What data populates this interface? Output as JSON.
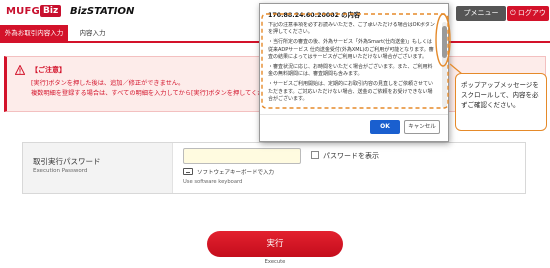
{
  "header": {
    "logo_mufg": "MUFG",
    "logo_biz": "Biz",
    "logo_bizstation": "BizSTATION",
    "menu_label": "プメニュー",
    "logout_label": "ログアウト"
  },
  "tabs": [
    {
      "label": "外為お取引内容入力",
      "active": true
    },
    {
      "label": "内容入力",
      "active": false
    }
  ],
  "warning": {
    "title": "【ご注意】",
    "line1": "[実行]ボタンを押した後は、追加／修正ができません。",
    "line2": "複数明細を登録する場合は、すべての明細を入力してから[実行]ボタンを押してください。"
  },
  "form": {
    "label": "取引実行パスワード",
    "sublabel": "Execution Password",
    "show_password": "パスワードを表示",
    "software_keyboard": "ソフトウェアキーボードで入力",
    "software_keyboard_en": "Use software keyboard"
  },
  "execute": {
    "label": "実行",
    "sublabel": "Execute"
  },
  "popup": {
    "title": "170.88.24.60:20002 の内容",
    "paragraphs": [
      "下記の注意事項を必ずお読みいただき、ご了承いただける場合はOKボタンを押してください。",
      "・当行所定の審査の後、外為サービス「外為Smart(仕向送金)」もしくは従来ADPサービス 仕向送金受付(外為XML)のご利用が可能となります。審査の結果によってはサービスがご利用いただけない場合がございます。",
      "・審査状況に応じ、お時間をいただく場合がございます。また、ご利用料金の無料期間には、審査期間も含みます。",
      "・サービスご利用開始は、定期的にお取引内容の見直しをご依頼させていただきます。ご対応いただけない場合、送金のご依頼をお受けできない場合がございます。"
    ],
    "ok_label": "OK",
    "cancel_label": "キャンセル"
  },
  "callout": {
    "text": "ポップアップメッセージをスクロールして、内容を必ずご確認ください。"
  },
  "colors": {
    "brand_red": "#d3122a",
    "ok_blue": "#1a5fcf",
    "annotation_orange": "#e58a2a"
  }
}
